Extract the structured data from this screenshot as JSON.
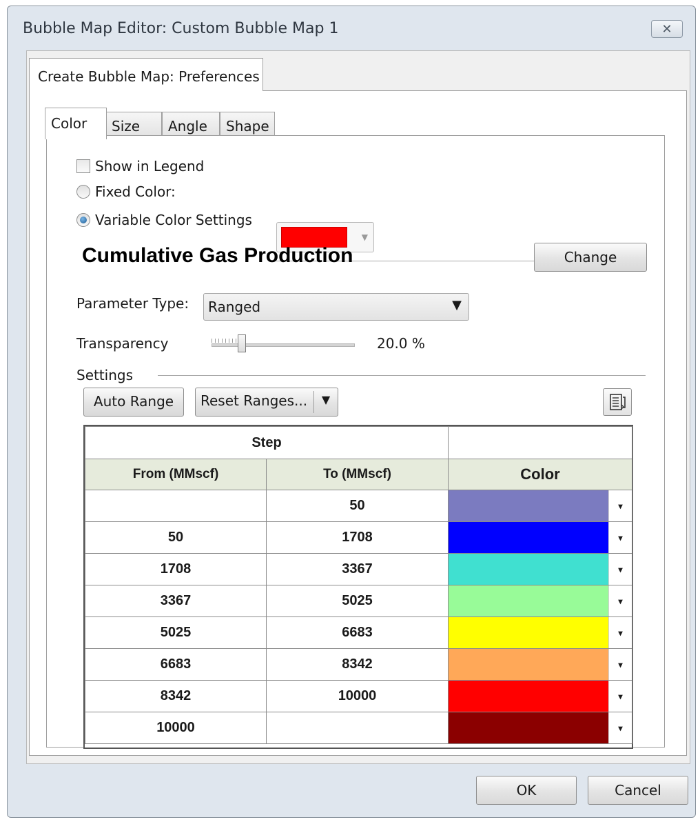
{
  "window": {
    "title": "Bubble Map Editor: Custom Bubble Map 1",
    "close_glyph": "✕"
  },
  "outer_tab": {
    "label": "Create Bubble Map: Preferences"
  },
  "inner_tabs": [
    {
      "label": "Color",
      "active": true
    },
    {
      "label": "Size",
      "active": false
    },
    {
      "label": "Angle",
      "active": false
    },
    {
      "label": "Shape",
      "active": false
    }
  ],
  "options": {
    "show_in_legend": {
      "label": "Show in Legend",
      "checked": false
    },
    "fixed_color": {
      "label": "Fixed Color:",
      "selected": false,
      "color": "#ff0000"
    },
    "variable_color": {
      "label": "Variable Color Settings",
      "selected": true
    }
  },
  "parameter": {
    "name": "Cumulative Gas Production",
    "change_label": "Change",
    "type_label": "Parameter Type:",
    "type_value": "Ranged",
    "type_arrow": "▼"
  },
  "transparency": {
    "label": "Transparency",
    "value_text": "20.0 %",
    "value": 20.0
  },
  "settings": {
    "label": "Settings",
    "auto_range_label": "Auto Range",
    "reset_ranges_label": "Reset Ranges...",
    "reset_ranges_arrow": "▼"
  },
  "table": {
    "group_header": "Step",
    "columns": [
      "From (MMscf)",
      "To (MMscf)",
      "Color"
    ],
    "dropdown_glyph": "▾",
    "rows": [
      {
        "from": "",
        "to": "50",
        "color": "#7b7bc0"
      },
      {
        "from": "50",
        "to": "1708",
        "color": "#0000ff"
      },
      {
        "from": "1708",
        "to": "3367",
        "color": "#40e0d0"
      },
      {
        "from": "3367",
        "to": "5025",
        "color": "#98fb98"
      },
      {
        "from": "5025",
        "to": "6683",
        "color": "#ffff00"
      },
      {
        "from": "6683",
        "to": "8342",
        "color": "#ffa858"
      },
      {
        "from": "8342",
        "to": "10000",
        "color": "#ff0000"
      },
      {
        "from": "10000",
        "to": "",
        "color": "#8b0000"
      }
    ]
  },
  "footer": {
    "ok_label": "OK",
    "cancel_label": "Cancel"
  }
}
